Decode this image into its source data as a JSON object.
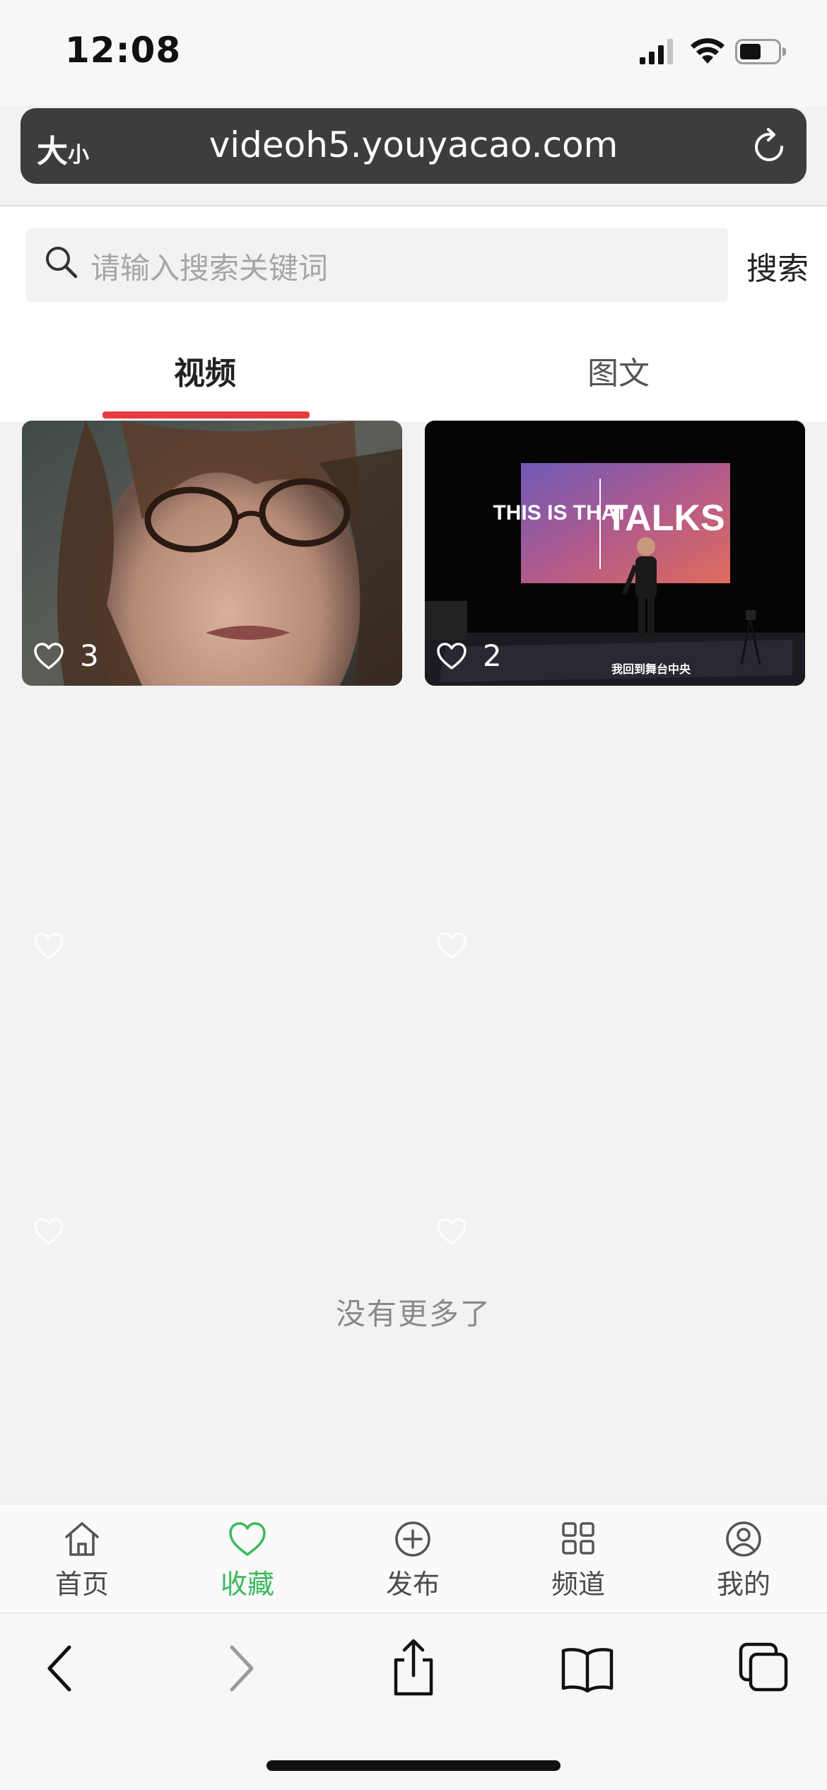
{
  "status_bar": {
    "time": "12:08"
  },
  "browser": {
    "text_size_big": "大",
    "text_size_small": "小",
    "url": "videoh5.youyacao.com"
  },
  "search": {
    "placeholder": "请输入搜索关键词",
    "button_label": "搜索"
  },
  "tabs": [
    {
      "label": "视频",
      "active": true
    },
    {
      "label": "图文",
      "active": false
    }
  ],
  "cards": [
    {
      "likes": "3"
    },
    {
      "likes": "2",
      "slide_brand_left": "THIS IS THAT",
      "slide_brand_right": "TALKS",
      "subtitle": "我回到舞台中央"
    }
  ],
  "empty_message": "没有更多了",
  "bottom_nav": [
    {
      "label": "首页",
      "icon": "home-icon"
    },
    {
      "label": "收藏",
      "icon": "heart-icon",
      "active": true
    },
    {
      "label": "发布",
      "icon": "plus-circle-icon"
    },
    {
      "label": "频道",
      "icon": "grid-icon"
    },
    {
      "label": "我的",
      "icon": "user-icon"
    }
  ],
  "colors": {
    "accent_red": "#e83a3a",
    "active_green": "#3cb95c",
    "url_bar": "#3d3d3d"
  }
}
